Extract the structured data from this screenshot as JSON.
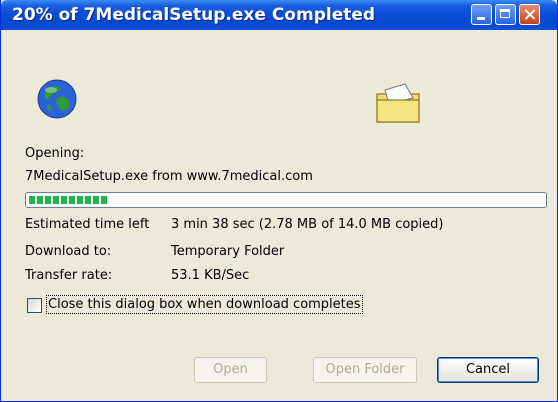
{
  "window": {
    "title": "20% of 7MedicalSetup.exe Completed",
    "controls": {
      "minimize": "minimize-icon",
      "maximize": "maximize-icon",
      "close": "close-icon"
    }
  },
  "status": {
    "opening_label": "Opening:",
    "file_line": "7MedicalSetup.exe from www.7medical.com",
    "progress_fraction": 0.2,
    "progress_segments": 10,
    "details": [
      {
        "label": "Estimated time left",
        "value": "3 min 38 sec (2.78 MB of 14.0 MB copied)"
      },
      {
        "label": "Download to:",
        "value": "Temporary Folder"
      },
      {
        "label": "Transfer rate:",
        "value": "53.1 KB/Sec"
      }
    ]
  },
  "option": {
    "close_when_done_label": "Close this dialog box when download completes",
    "checked": false
  },
  "buttons": {
    "open": "Open",
    "open_folder": "Open Folder",
    "cancel": "Cancel"
  },
  "colors": {
    "titlebar": "#0a4fd8",
    "progress_fill": "#22b14c",
    "dialog_bg": "#ece9d8"
  }
}
